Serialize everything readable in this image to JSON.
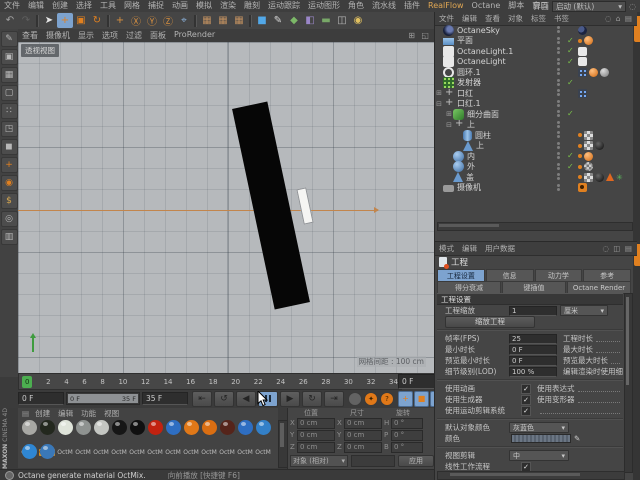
{
  "window": {
    "interface_label": "界面",
    "layout_value": "启动 (默认)"
  },
  "menubar": {
    "items": [
      {
        "label": "文件"
      },
      {
        "label": "编辑"
      },
      {
        "label": "创建"
      },
      {
        "label": "选择"
      },
      {
        "label": "工具"
      },
      {
        "label": "网格"
      },
      {
        "label": "捕捉"
      },
      {
        "label": "动画"
      },
      {
        "label": "模拟"
      },
      {
        "label": "渲染"
      },
      {
        "label": "雕刻"
      },
      {
        "label": "运动跟踪"
      },
      {
        "label": "运动图形"
      },
      {
        "label": "角色"
      },
      {
        "label": "流水线"
      },
      {
        "label": "插件"
      },
      {
        "label": "RealFlow",
        "hl": "1"
      },
      {
        "label": "Octane"
      },
      {
        "label": "脚本"
      },
      {
        "label": "窗口"
      },
      {
        "label": "帮助"
      }
    ]
  },
  "toolbar": {
    "items": [
      {
        "n": "undo-icon",
        "g": "↶",
        "c": "#a2a2a2"
      },
      {
        "n": "redo-icon",
        "g": "↷",
        "c": "#5f5f5f"
      },
      {
        "sep": "1"
      },
      {
        "n": "live-selection-icon",
        "g": "➤",
        "c": "#e6e6e6"
      },
      {
        "n": "move-tool-icon",
        "g": "+",
        "c": "#e08020",
        "bg": "#7da3cf"
      },
      {
        "n": "scale-tool-icon",
        "g": "▣",
        "c": "#e08020"
      },
      {
        "n": "rotate-tool-icon",
        "g": "↻",
        "c": "#e08020"
      },
      {
        "sep": "1"
      },
      {
        "n": "last-tool-icon",
        "g": "+",
        "c": "#d89040"
      },
      {
        "n": "x-axis-lock-icon",
        "g": "Ⓧ",
        "c": "#d89040"
      },
      {
        "n": "y-axis-lock-icon",
        "g": "Ⓨ",
        "c": "#d89040"
      },
      {
        "n": "z-axis-lock-icon",
        "g": "Ⓩ",
        "c": "#d89040"
      },
      {
        "n": "coord-system-icon",
        "g": "⌖",
        "c": "#8ab0d8"
      },
      {
        "sep": "1"
      },
      {
        "n": "render-view-icon",
        "g": "▦",
        "c": "#c09060"
      },
      {
        "n": "render-picture-viewer-icon",
        "g": "▦",
        "c": "#c09060"
      },
      {
        "n": "render-settings-icon",
        "g": "▦",
        "c": "#c09060"
      },
      {
        "sep": "1"
      },
      {
        "n": "add-cube-icon",
        "g": "■",
        "c": "#52a8e8"
      },
      {
        "n": "spline-pen-icon",
        "g": "✎",
        "c": "#d8d8d8"
      },
      {
        "n": "generator-icon",
        "g": "◆",
        "c": "#7cb868"
      },
      {
        "n": "deformer-icon",
        "g": "◧",
        "c": "#9a86c8"
      },
      {
        "n": "floor-icon",
        "g": "▬",
        "c": "#78a868"
      },
      {
        "n": "camera-icon",
        "g": "◫",
        "c": "#b8b8b8"
      },
      {
        "n": "light-icon",
        "g": "◉",
        "c": "#e0c060"
      }
    ]
  },
  "left_toolbar": {
    "items": [
      {
        "n": "make-editable-icon",
        "g": "✎",
        "c": "#b8b8b8"
      },
      {
        "n": "model-mode-icon",
        "g": "▣",
        "c": "#b8b8b8"
      },
      {
        "n": "texture-mode-icon",
        "g": "▦",
        "c": "#b8b8b8"
      },
      {
        "n": "workplane-mode-icon",
        "g": "▢",
        "c": "#b8b8b8"
      },
      {
        "n": "points-mode-icon",
        "g": "∷",
        "c": "#b8b8b8"
      },
      {
        "n": "edges-mode-icon",
        "g": "◳",
        "c": "#b8b8b8"
      },
      {
        "n": "polygons-mode-icon",
        "g": "◼",
        "c": "#b8b8b8"
      },
      {
        "n": "enable-axis-icon",
        "g": "+",
        "c": "#e08020"
      },
      {
        "n": "axis-center-icon",
        "g": "◉",
        "c": "#e08020"
      },
      {
        "n": "snap-icon",
        "g": "$",
        "c": "#d8a850"
      },
      {
        "n": "workplane-lock-icon",
        "g": "◎",
        "c": "#b8b8b8"
      },
      {
        "n": "viewport-solo-icon",
        "g": "▥",
        "c": "#b8b8b8"
      }
    ]
  },
  "viewport": {
    "menus": [
      "查看",
      "摄像机",
      "显示",
      "选项",
      "过滤",
      "面板",
      "ProRender"
    ],
    "view_label": "透视视图",
    "grid_label": "网格间距 : 100 cm",
    "corner_icons": "⊞ ◱"
  },
  "object_manager": {
    "menus": [
      "文件",
      "编辑",
      "查看",
      "对象",
      "标签",
      "书签"
    ],
    "icons": "◌ ⌂ ▤",
    "objects": [
      {
        "name": "OctaneSky",
        "pad": "0px",
        "exp": "",
        "icls": "oi oi-sky",
        "check": "",
        "tags": [
          {
            "cls": "tg tg-moon"
          }
        ]
      },
      {
        "name": "平面",
        "pad": "0px",
        "exp": "",
        "icls": "oi oi-plane",
        "check": "✓",
        "tags": [
          {
            "cls": "tg tg-dot"
          },
          {
            "cls": "tg tg-ball"
          }
        ]
      },
      {
        "name": "OctaneLight.1",
        "pad": "0px",
        "exp": "",
        "icls": "oi oi-area",
        "check": "✓",
        "tags": [
          {
            "cls": "tg tg-rect"
          }
        ]
      },
      {
        "name": "OctaneLight",
        "pad": "0px",
        "exp": "",
        "icls": "oi oi-area",
        "check": "✓",
        "tags": [
          {
            "cls": "tg tg-rect"
          }
        ]
      },
      {
        "name": "圆环.1",
        "pad": "0px",
        "exp": "",
        "icls": "oi oi-circle",
        "check": "",
        "tags": [
          {
            "cls": "tg tg-grid"
          },
          {
            "cls": "tg tg-ball"
          },
          {
            "cls": "tg tg-ballg"
          }
        ]
      },
      {
        "name": "发射器",
        "pad": "0px",
        "exp": "",
        "icls": "oi oi-emitter",
        "check": "✓",
        "tags": []
      },
      {
        "name": "口红",
        "pad": "0px",
        "exp": "⊞",
        "icls": "oi oi-null",
        "check": "",
        "tags": [
          {
            "cls": "tg tg-grid"
          }
        ]
      },
      {
        "name": "口红.1",
        "pad": "0px",
        "exp": "⊟",
        "icls": "oi oi-null",
        "check": "",
        "tags": []
      },
      {
        "name": "细分曲面",
        "pad": "10px",
        "exp": "⊞",
        "icls": "oi oi-subdiv",
        "check": "✓",
        "tags": []
      },
      {
        "name": "上",
        "pad": "10px",
        "exp": "⊟",
        "icls": "oi oi-null",
        "check": "",
        "tags": []
      },
      {
        "name": "圆柱",
        "pad": "20px",
        "exp": "",
        "icls": "oi oi-cyl",
        "check": "",
        "tags": [
          {
            "cls": "tg tg-dot"
          },
          {
            "cls": "tg tg-checker"
          }
        ]
      },
      {
        "name": "上",
        "pad": "20px",
        "exp": "",
        "icls": "oi oi-cone",
        "check": "",
        "tags": [
          {
            "cls": "tg tg-dot"
          },
          {
            "cls": "tg tg-checker"
          },
          {
            "cls": "tg tg-ballk"
          }
        ]
      },
      {
        "name": "内",
        "pad": "10px",
        "exp": "",
        "icls": "oi oi-sphere",
        "check": "✓",
        "tags": [
          {
            "cls": "tg tg-dot"
          },
          {
            "cls": "tg tg-ball"
          }
        ]
      },
      {
        "name": "外",
        "pad": "10px",
        "exp": "",
        "icls": "oi oi-sphere",
        "check": "✓",
        "tags": [
          {
            "cls": "tg tg-dot"
          },
          {
            "cls": "tg tg-checker2"
          }
        ]
      },
      {
        "name": "盖",
        "pad": "10px",
        "exp": "",
        "icls": "oi oi-cone",
        "check": "",
        "tags": [
          {
            "cls": "tg tg-dot"
          },
          {
            "cls": "tg tg-checker"
          },
          {
            "cls": "tg tg-ballk"
          },
          {
            "cls": "tg tg-tri"
          },
          {
            "cls": "tg tg-part"
          }
        ]
      },
      {
        "name": "摄像机",
        "pad": "0px",
        "exp": "",
        "icls": "oi oi-cam",
        "check": "",
        "tags": [
          {
            "cls": "tg tg-cam"
          }
        ]
      }
    ]
  },
  "attribute_manager": {
    "mode_tabs": [
      "模式",
      "编辑",
      "用户数据"
    ],
    "icons": "◌ ◫ ▤",
    "object_label": "工程",
    "tabs_row1": [
      {
        "label": "工程设置",
        "active": "1"
      },
      {
        "label": "信息",
        "active": "0"
      },
      {
        "label": "动力学",
        "active": "0"
      },
      {
        "label": "参考",
        "active": "0"
      }
    ],
    "tabs_row2": [
      {
        "label": "得分衰减",
        "active": "0"
      },
      {
        "label": "键插值",
        "active": "0"
      },
      {
        "label": "Octane Render",
        "active": "0"
      }
    ],
    "section": "工程设置",
    "scale_label": "工程缩放",
    "scale_value": "1",
    "scale_unit": "厘米",
    "scale_button": "缩放工程",
    "rows": [
      {
        "l": "帧率(FPS)",
        "v": "25",
        "r": "工程时长"
      },
      {
        "l": "最小时长",
        "v": "0 F",
        "r": "最大时长"
      },
      {
        "l": "预览最小时长",
        "v": "0 F",
        "r": "预览最大时长"
      },
      {
        "l": "细节级别(LOD)",
        "v": "100 %",
        "r": "编辑渲染时使用细节级别LOD"
      }
    ],
    "checks": [
      {
        "l": "使用动画",
        "r": "使用表达式"
      },
      {
        "l": "使用生成器",
        "r": "使用变形器"
      },
      {
        "l": "使用运动剪辑系统",
        "r": ""
      }
    ],
    "default_color_label": "默认对象颜色",
    "default_color_value": "灰蓝色",
    "color_label": "颜色",
    "view_clip_label": "视图剪辑",
    "view_clip_value": "中",
    "linear_label": "线性工作流程"
  },
  "timeline": {
    "ticks": [
      "0",
      "2",
      "4",
      "6",
      "8",
      "10",
      "12",
      "14",
      "16",
      "18",
      "20",
      "22",
      "24",
      "26",
      "28",
      "30",
      "32",
      "34"
    ],
    "current": "0 F",
    "start": "0 F",
    "end": "35 F",
    "range_start": "0 F",
    "range_end": "35 F"
  },
  "transport": {
    "buttons": [
      {
        "g": "⇤"
      },
      {
        "g": "↺"
      },
      {
        "g": "◀"
      },
      {
        "g": "",
        "active": "true"
      },
      {
        "g": "▶"
      },
      {
        "g": "↻"
      },
      {
        "g": "⇥"
      }
    ],
    "record": [
      {
        "g": "",
        "bg": "#636363",
        "fg": "#333"
      },
      {
        "g": "✦",
        "bg": "#e07818",
        "fg": "#3a2000"
      },
      {
        "g": "?",
        "bg": "#e07818",
        "fg": "#3a2000"
      }
    ],
    "keying": [
      {
        "g": "+",
        "c": "#e08020"
      },
      {
        "g": "■",
        "c": "#e08020"
      },
      {
        "g": "○",
        "c": "#e08020"
      },
      {
        "g": "Ⓟ",
        "c": "#30363c"
      },
      {
        "g": "⠿",
        "c": "#e08020"
      }
    ],
    "timeline_button": "≣"
  },
  "materials": {
    "menus": [
      "创建",
      "编辑",
      "功能",
      "视图"
    ],
    "items": [
      {
        "label": "OctM",
        "color": "#a8a8a4",
        "sel": "0"
      },
      {
        "label": "OctM",
        "color": "#23281e",
        "sel": "1"
      },
      {
        "label": "OctM",
        "color": "#dfe4da",
        "sel": "0"
      },
      {
        "label": "OctM",
        "color": "#8e9290",
        "sel": "0"
      },
      {
        "label": "OctM",
        "color": "#c4c6c2",
        "sel": "0"
      },
      {
        "label": "OctM",
        "color": "#161616",
        "sel": "0"
      },
      {
        "label": "OctM",
        "color": "#101010",
        "sel": "0"
      },
      {
        "label": "OctM",
        "color": "#c22210",
        "sel": "0"
      },
      {
        "label": "OctM",
        "color": "#2e6ec2",
        "sel": "0"
      },
      {
        "label": "OctM",
        "color": "#e07818",
        "sel": "0"
      },
      {
        "label": "OctM",
        "color": "#da6e12",
        "sel": "0"
      },
      {
        "label": "OctM",
        "color": "#55241a",
        "sel": "0"
      },
      {
        "label": "OctM",
        "color": "#2e6ec2",
        "sel": "0"
      },
      {
        "label": "OctM",
        "color": "#3380c8",
        "sel": "0"
      },
      {
        "label": "OctM",
        "color": "#2f86d2",
        "sel": "0"
      },
      {
        "label": "OctM",
        "color": "#3a78b8",
        "sel": "0"
      }
    ]
  },
  "coordinates": {
    "headers": [
      "位置",
      "尺寸",
      "旋转"
    ],
    "rows": [
      {
        "a": "X",
        "av": "0 cm",
        "b": "X",
        "bv": "0 cm",
        "c": "H",
        "cv": "0 °"
      },
      {
        "a": "Y",
        "av": "0 cm",
        "b": "Y",
        "bv": "0 cm",
        "c": "P",
        "cv": "0 °"
      },
      {
        "a": "Z",
        "av": "0 cm",
        "b": "Z",
        "bv": "0 cm",
        "c": "B",
        "cv": "0 °"
      }
    ],
    "mode_value": "对象 (相对)",
    "apply_label": "应用"
  },
  "status": {
    "message": "Octane generate material OctMix.",
    "hint": "向前播放 [快捷键 F6]"
  },
  "logo": {
    "brand": "MAXON",
    "product": "CINEMA 4D"
  }
}
